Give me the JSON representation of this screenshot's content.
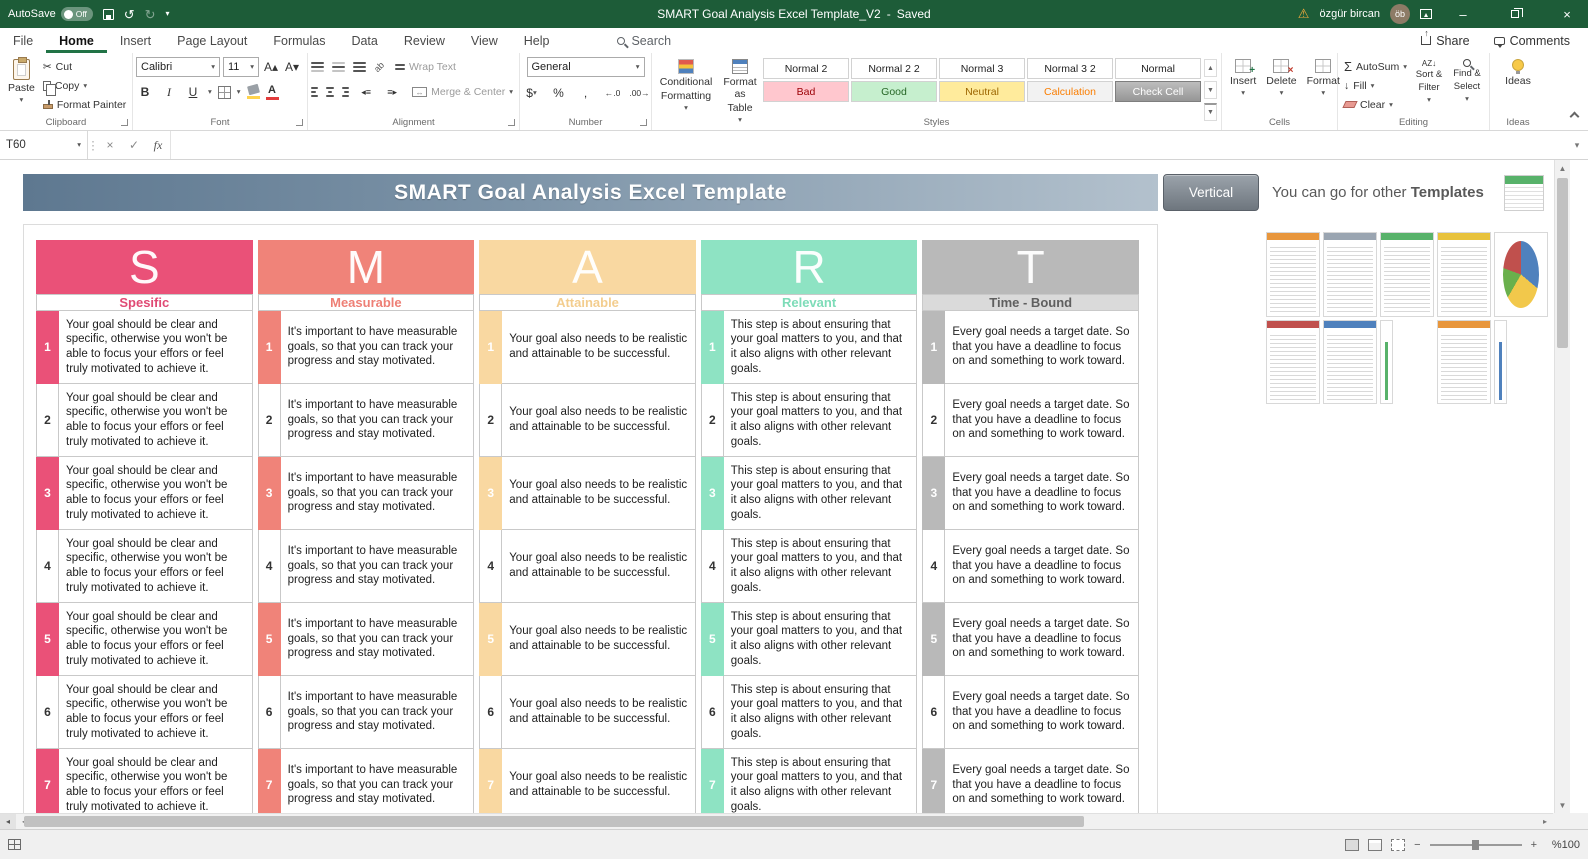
{
  "titlebar": {
    "autosave_label": "AutoSave",
    "autosave_state": "Off",
    "doc_title": "SMART Goal Analysis Excel Template_V2",
    "dash": "-",
    "saved_status": "Saved",
    "user_name": "özgür bircan"
  },
  "ribbon_tabs": [
    "File",
    "Home",
    "Insert",
    "Page Layout",
    "Formulas",
    "Data",
    "Review",
    "View",
    "Help"
  ],
  "active_tab_index": 1,
  "tabrow": {
    "search": "Search",
    "share": "Share",
    "comments": "Comments"
  },
  "ribbon": {
    "clipboard": {
      "label": "Clipboard",
      "paste": "Paste",
      "cut": "Cut",
      "copy": "Copy",
      "format_painter": "Format Painter"
    },
    "font": {
      "label": "Font",
      "name": "Calibri",
      "size": "11",
      "bold": "B",
      "italic": "I",
      "underline": "U"
    },
    "alignment": {
      "label": "Alignment",
      "wrap": "Wrap Text",
      "merge": "Merge & Center"
    },
    "number": {
      "label": "Number",
      "format": "General",
      "currency": "$",
      "percent": "%",
      "comma": ","
    },
    "styles": {
      "label": "Styles",
      "conditional_line1": "Conditional",
      "conditional_line2": "Formatting",
      "format_table_line1": "Format as",
      "format_table_line2": "Table",
      "chips": [
        {
          "label": "Normal 2",
          "bg": "#ffffff",
          "fg": "#1f1f1f"
        },
        {
          "label": "Normal 2 2",
          "bg": "#ffffff",
          "fg": "#1f1f1f"
        },
        {
          "label": "Normal 3",
          "bg": "#ffffff",
          "fg": "#1f1f1f"
        },
        {
          "label": "Normal 3 2",
          "bg": "#ffffff",
          "fg": "#1f1f1f"
        },
        {
          "label": "Normal",
          "bg": "#ffffff",
          "fg": "#1f1f1f"
        },
        {
          "label": "Bad",
          "bg": "#ffc7ce",
          "fg": "#9c0006"
        },
        {
          "label": "Good",
          "bg": "#c6efce",
          "fg": "#276727"
        },
        {
          "label": "Neutral",
          "bg": "#ffeb9c",
          "fg": "#9c6500"
        },
        {
          "label": "Calculation",
          "bg": "#f2f2f2",
          "fg": "#fa7d00"
        },
        {
          "label": "Check Cell",
          "bg": "#a5a5a5",
          "fg": "#ffffff"
        }
      ]
    },
    "cells": {
      "label": "Cells",
      "insert": "Insert",
      "delete": "Delete",
      "format": "Format"
    },
    "editing": {
      "label": "Editing",
      "autosum": "AutoSum",
      "fill": "Fill",
      "clear": "Clear",
      "sort_line1": "Sort &",
      "sort_line2": "Filter",
      "find_line1": "Find &",
      "find_line2": "Select"
    },
    "ideas": {
      "label": "Ideas",
      "button": "Ideas"
    }
  },
  "formula_bar": {
    "name_box": "T60",
    "fx": "fx"
  },
  "sheet": {
    "banner_title": "SMART Goal Analysis Excel Template",
    "vertical_button": "Vertical",
    "promo_prefix": "You can go for other",
    "promo_bold": "Templates",
    "columns": [
      {
        "letter": "S",
        "subtitle": "Spesific",
        "color": "#ea5178",
        "subtitle_color": "#e04a74",
        "subtitle_bg": "#ffffff",
        "text": "Your goal should be clear and specific, otherwise you won't be able to focus your effors or feel truly motivated to achieve it."
      },
      {
        "letter": "M",
        "subtitle": "Measurable",
        "color": "#f08379",
        "subtitle_color": "#ee7f75",
        "subtitle_bg": "#ffffff",
        "text": "It's important to have measurable goals, so that you can track your progress and stay motivated."
      },
      {
        "letter": "A",
        "subtitle": "Attainable",
        "color": "#f9d8a1",
        "subtitle_color": "#f3cd8e",
        "subtitle_bg": "#ffffff",
        "text": "Your goal also needs to be realistic and attainable to be successful."
      },
      {
        "letter": "R",
        "subtitle": "Relevant",
        "color": "#8ee3c3",
        "subtitle_color": "#7ddcb8",
        "subtitle_bg": "#ffffff",
        "text": "This step is about ensuring that your goal matters to you, and that it also aligns with other relevant goals."
      },
      {
        "letter": "T",
        "subtitle": "Time - Bound",
        "color": "#b9b9b9",
        "subtitle_color": "#5f5f5f",
        "subtitle_bg": "#dadada",
        "text": "Every goal needs a target date. So that you have a deadline to focus on and something to work toward."
      }
    ],
    "row_numbers": [
      1,
      2,
      3,
      4,
      5,
      6,
      7
    ]
  },
  "thumbnails": [
    {
      "type": "sheet1",
      "accent": "#e8963c"
    },
    {
      "type": "sheet1",
      "accent": "#9aa5b1"
    },
    {
      "type": "sheet1",
      "accent": "#58b26a"
    },
    {
      "type": "sheet1",
      "accent": "#e8c23c"
    },
    {
      "type": "pie",
      "accent": "#4f81bd"
    },
    {
      "type": "sheet1",
      "accent": "#c0504d"
    },
    {
      "type": "sheet1",
      "accent": "#4f81bd"
    },
    {
      "type": "bars",
      "accent": "#58b26a"
    },
    {
      "type": "sheet1",
      "accent": "#e8963c"
    },
    {
      "type": "bars",
      "accent": "#4f81bd"
    }
  ],
  "status_bar": {
    "zoom_level": "%100"
  },
  "colors": {
    "title_green": "#1d5c38",
    "accent_green": "#217346",
    "banner_from": "#5e7890",
    "banner_to": "#b3c1cd"
  }
}
